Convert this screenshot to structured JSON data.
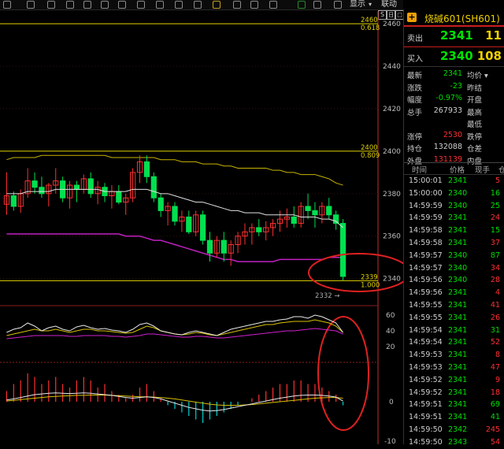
{
  "toolbar": {
    "display_label": "显示",
    "link_label": "联动",
    "window_controls": [
      "S",
      "日",
      "□",
      "×"
    ]
  },
  "chart_data": {
    "type": "candlestick",
    "y_ticks": [
      "2460",
      "2440",
      "2420",
      "2400",
      "2380",
      "2360",
      "2340"
    ],
    "fib_levels": [
      {
        "price": "2460",
        "ratio": "0.618"
      },
      {
        "price": "2400",
        "ratio": "0.809"
      },
      {
        "price": "2339",
        "ratio": "1.000"
      }
    ],
    "low_marker": "2332",
    "ylim": [
      2328,
      2466
    ],
    "candles": [
      [
        2375,
        2390,
        2370,
        2379
      ],
      [
        2379,
        2381,
        2372,
        2374
      ],
      [
        2374,
        2382,
        2371,
        2380
      ],
      [
        2380,
        2392,
        2378,
        2386
      ],
      [
        2386,
        2390,
        2380,
        2383
      ],
      [
        2383,
        2388,
        2378,
        2380
      ],
      [
        2380,
        2385,
        2374,
        2384
      ],
      [
        2384,
        2392,
        2380,
        2386
      ],
      [
        2386,
        2388,
        2376,
        2378
      ],
      [
        2378,
        2386,
        2373,
        2384
      ],
      [
        2384,
        2386,
        2376,
        2382
      ],
      [
        2382,
        2389,
        2380,
        2387
      ],
      [
        2387,
        2390,
        2378,
        2380
      ],
      [
        2380,
        2386,
        2375,
        2383
      ],
      [
        2383,
        2385,
        2376,
        2379
      ],
      [
        2379,
        2384,
        2373,
        2381
      ],
      [
        2381,
        2384,
        2375,
        2376
      ],
      [
        2376,
        2380,
        2370,
        2378
      ],
      [
        2378,
        2392,
        2376,
        2390
      ],
      [
        2390,
        2398,
        2385,
        2395
      ],
      [
        2395,
        2398,
        2385,
        2388
      ],
      [
        2388,
        2390,
        2376,
        2378
      ],
      [
        2378,
        2380,
        2369,
        2372
      ],
      [
        2372,
        2376,
        2365,
        2374
      ],
      [
        2374,
        2376,
        2365,
        2367
      ],
      [
        2367,
        2372,
        2362,
        2369
      ],
      [
        2369,
        2372,
        2361,
        2362
      ],
      [
        2362,
        2372,
        2360,
        2370
      ],
      [
        2370,
        2372,
        2356,
        2358
      ],
      [
        2358,
        2362,
        2348,
        2352
      ],
      [
        2352,
        2360,
        2350,
        2358
      ],
      [
        2358,
        2362,
        2348,
        2352
      ],
      [
        2352,
        2358,
        2346,
        2356
      ],
      [
        2356,
        2362,
        2352,
        2360
      ],
      [
        2360,
        2366,
        2356,
        2362
      ],
      [
        2362,
        2366,
        2356,
        2364
      ],
      [
        2364,
        2368,
        2360,
        2362
      ],
      [
        2362,
        2367,
        2358,
        2364
      ],
      [
        2364,
        2368,
        2360,
        2366
      ],
      [
        2366,
        2372,
        2362,
        2368
      ],
      [
        2368,
        2373,
        2364,
        2369
      ],
      [
        2369,
        2374,
        2364,
        2366
      ],
      [
        2366,
        2376,
        2364,
        2374
      ],
      [
        2374,
        2380,
        2368,
        2372
      ],
      [
        2372,
        2376,
        2364,
        2370
      ],
      [
        2370,
        2376,
        2366,
        2374
      ],
      [
        2374,
        2378,
        2368,
        2370
      ],
      [
        2370,
        2372,
        2363,
        2366
      ],
      [
        2366,
        2368,
        2339,
        2341
      ]
    ],
    "ma_line_white": [
      2380,
      2380,
      2380,
      2381,
      2381,
      2381,
      2381,
      2382,
      2382,
      2382,
      2382,
      2382,
      2382,
      2382,
      2381,
      2381,
      2381,
      2381,
      2382,
      2382,
      2382,
      2381,
      2380,
      2380,
      2379,
      2378,
      2377,
      2376,
      2376,
      2375,
      2374,
      2373,
      2372,
      2372,
      2371,
      2371,
      2371,
      2370,
      2370,
      2370,
      2370,
      2370,
      2369,
      2369,
      2369,
      2368,
      2368,
      2367,
      2364
    ],
    "ma_line_yellow": [
      2396,
      2397,
      2397,
      2397,
      2397,
      2398,
      2398,
      2398,
      2398,
      2398,
      2398,
      2398,
      2398,
      2398,
      2398,
      2397,
      2397,
      2397,
      2397,
      2397,
      2397,
      2397,
      2396,
      2396,
      2396,
      2395,
      2395,
      2395,
      2394,
      2394,
      2394,
      2393,
      2393,
      2392,
      2392,
      2392,
      2392,
      2392,
      2391,
      2391,
      2390,
      2390,
      2389,
      2389,
      2389,
      2388,
      2387,
      2385,
      2384
    ],
    "ma_line_magenta": [
      2361,
      2361,
      2361,
      2361,
      2361,
      2361,
      2361,
      2361,
      2361,
      2361,
      2361,
      2361,
      2361,
      2361,
      2361,
      2361,
      2361,
      2360,
      2360,
      2360,
      2359,
      2358,
      2358,
      2357,
      2356,
      2355,
      2354,
      2353,
      2352,
      2351,
      2350,
      2349,
      2349,
      2348,
      2348,
      2348,
      2348,
      2348,
      2348,
      2349,
      2349,
      2349,
      2349,
      2349,
      2349,
      2349,
      2350,
      2350,
      2350
    ],
    "osc_ticks": [
      "60",
      "40",
      "20"
    ],
    "osc_white": [
      38,
      42,
      44,
      50,
      46,
      40,
      44,
      46,
      42,
      40,
      45,
      47,
      44,
      42,
      43,
      41,
      40,
      38,
      42,
      48,
      50,
      46,
      40,
      38,
      36,
      35,
      38,
      40,
      38,
      36,
      34,
      38,
      42,
      44,
      46,
      48,
      50,
      52,
      52,
      54,
      55,
      58,
      58,
      56,
      60,
      58,
      54,
      50,
      38
    ],
    "osc_yellow": [
      34,
      36,
      38,
      40,
      42,
      40,
      40,
      42,
      40,
      38,
      40,
      42,
      42,
      40,
      40,
      39,
      38,
      37,
      38,
      42,
      46,
      44,
      40,
      38,
      36,
      35,
      36,
      38,
      37,
      35,
      34,
      36,
      38,
      40,
      42,
      44,
      46,
      48,
      48,
      50,
      51,
      52,
      52,
      52,
      54,
      52,
      50,
      46,
      38
    ],
    "osc_magenta": [
      30,
      31,
      32,
      33,
      34,
      34,
      34,
      34,
      34,
      33,
      33,
      34,
      34,
      34,
      34,
      33,
      33,
      32,
      33,
      34,
      36,
      36,
      35,
      34,
      33,
      32,
      32,
      33,
      33,
      32,
      31,
      31,
      32,
      33,
      34,
      35,
      36,
      37,
      38,
      39,
      40,
      40,
      41,
      42,
      43,
      42,
      41,
      40,
      36
    ],
    "macd_ticks": [
      "0",
      "-10"
    ],
    "macd_hist": [
      3,
      5,
      6,
      8,
      7,
      5,
      6,
      7,
      5,
      4,
      6,
      7,
      6,
      4,
      5,
      3,
      2,
      1,
      2,
      4,
      5,
      3,
      1,
      -1,
      -2,
      -3,
      -4,
      -5,
      -6,
      -5,
      -4,
      -3,
      -2,
      -1,
      0,
      1,
      2,
      3,
      4,
      5,
      5,
      6,
      6,
      5,
      5,
      4,
      3,
      2,
      -1
    ],
    "macd_white": [
      0.5,
      0.8,
      1.2,
      1.6,
      2.0,
      2.2,
      2.4,
      2.5,
      2.4,
      2.3,
      2.4,
      2.5,
      2.4,
      2.2,
      2.0,
      1.8,
      1.5,
      1.2,
      1.0,
      1.2,
      1.4,
      1.2,
      0.8,
      0.2,
      -0.4,
      -1.0,
      -1.6,
      -2.0,
      -2.4,
      -2.6,
      -2.5,
      -2.2,
      -1.8,
      -1.4,
      -1.0,
      -0.6,
      -0.2,
      0.2,
      0.6,
      1.0,
      1.3,
      1.6,
      1.8,
      1.9,
      1.9,
      1.8,
      1.6,
      1.3,
      0.2
    ],
    "macd_yellow": [
      0.2,
      0.4,
      0.6,
      0.8,
      1.0,
      1.2,
      1.4,
      1.5,
      1.6,
      1.7,
      1.8,
      1.8,
      1.9,
      1.9,
      1.9,
      1.8,
      1.7,
      1.6,
      1.5,
      1.4,
      1.4,
      1.3,
      1.2,
      1.0,
      0.8,
      0.5,
      0.2,
      -0.1,
      -0.4,
      -0.7,
      -0.9,
      -1.0,
      -1.0,
      -1.0,
      -0.9,
      -0.8,
      -0.6,
      -0.4,
      -0.2,
      0.0,
      0.2,
      0.4,
      0.6,
      0.8,
      1.0,
      1.1,
      1.2,
      1.2,
      1.0
    ]
  },
  "sidebar": {
    "title": "烧碱601(SH601)",
    "sell": {
      "label": "卖出",
      "price": "2341",
      "vol": "11"
    },
    "buy": {
      "label": "买入",
      "price": "2340",
      "vol": "108"
    },
    "stats": [
      {
        "l1": "最新",
        "v1": "2341",
        "c1": "g",
        "l2": "均价 ▾"
      },
      {
        "l1": "涨跌",
        "v1": "-23",
        "c1": "g",
        "l2": "昨结"
      },
      {
        "l1": "幅度",
        "v1": "-0.97%",
        "c1": "g",
        "l2": "开盘"
      },
      {
        "l1": "总手",
        "v1": "267933",
        "c1": "w",
        "l2": "最高"
      },
      {
        "l1": "",
        "v1": "",
        "c1": "w",
        "l2": "最低"
      },
      {
        "l1": "涨停",
        "v1": "2530",
        "c1": "r",
        "l2": "跌停"
      },
      {
        "l1": "持仓",
        "v1": "132088",
        "c1": "w",
        "l2": "仓差"
      },
      {
        "l1": "外盘",
        "v1": "131139",
        "c1": "r",
        "l2": "内盘"
      }
    ],
    "tick_headers": [
      "时间",
      "价格",
      "现手",
      "仓"
    ],
    "ticks": [
      {
        "t": "15:00:01",
        "p": "2341",
        "pc": "g",
        "v": "5",
        "vc": "r"
      },
      {
        "t": "15:00:00",
        "p": "2340",
        "pc": "g",
        "v": "16",
        "vc": "g"
      },
      {
        "t": "14:59:59",
        "p": "2340",
        "pc": "g",
        "v": "25",
        "vc": "g"
      },
      {
        "t": "14:59:59",
        "p": "2341",
        "pc": "g",
        "v": "24",
        "vc": "r"
      },
      {
        "t": "14:59:58",
        "p": "2341",
        "pc": "g",
        "v": "15",
        "vc": "g"
      },
      {
        "t": "14:59:58",
        "p": "2341",
        "pc": "g",
        "v": "37",
        "vc": "r"
      },
      {
        "t": "14:59:57",
        "p": "2340",
        "pc": "g",
        "v": "87",
        "vc": "g"
      },
      {
        "t": "14:59:57",
        "p": "2340",
        "pc": "g",
        "v": "34",
        "vc": "r"
      },
      {
        "t": "14:59:56",
        "p": "2340",
        "pc": "g",
        "v": "28",
        "vc": "r"
      },
      {
        "t": "14:59:56",
        "p": "2341",
        "pc": "g",
        "v": "4",
        "vc": "r"
      },
      {
        "t": "14:59:55",
        "p": "2341",
        "pc": "g",
        "v": "41",
        "vc": "r"
      },
      {
        "t": "14:59:55",
        "p": "2341",
        "pc": "g",
        "v": "26",
        "vc": "r"
      },
      {
        "t": "14:59:54",
        "p": "2341",
        "pc": "g",
        "v": "31",
        "vc": "g"
      },
      {
        "t": "14:59:54",
        "p": "2341",
        "pc": "g",
        "v": "52",
        "vc": "r"
      },
      {
        "t": "14:59:53",
        "p": "2341",
        "pc": "g",
        "v": "8",
        "vc": "r"
      },
      {
        "t": "14:59:53",
        "p": "2341",
        "pc": "g",
        "v": "47",
        "vc": "r"
      },
      {
        "t": "14:59:52",
        "p": "2341",
        "pc": "g",
        "v": "9",
        "vc": "r"
      },
      {
        "t": "14:59:52",
        "p": "2341",
        "pc": "g",
        "v": "18",
        "vc": "r"
      },
      {
        "t": "14:59:51",
        "p": "2341",
        "pc": "g",
        "v": "69",
        "vc": "g"
      },
      {
        "t": "14:59:51",
        "p": "2341",
        "pc": "g",
        "v": "41",
        "vc": "g"
      },
      {
        "t": "14:59:50",
        "p": "2342",
        "pc": "g",
        "v": "245",
        "vc": "r"
      },
      {
        "t": "14:59:50",
        "p": "2343",
        "pc": "g",
        "v": "54",
        "vc": "r"
      }
    ]
  }
}
